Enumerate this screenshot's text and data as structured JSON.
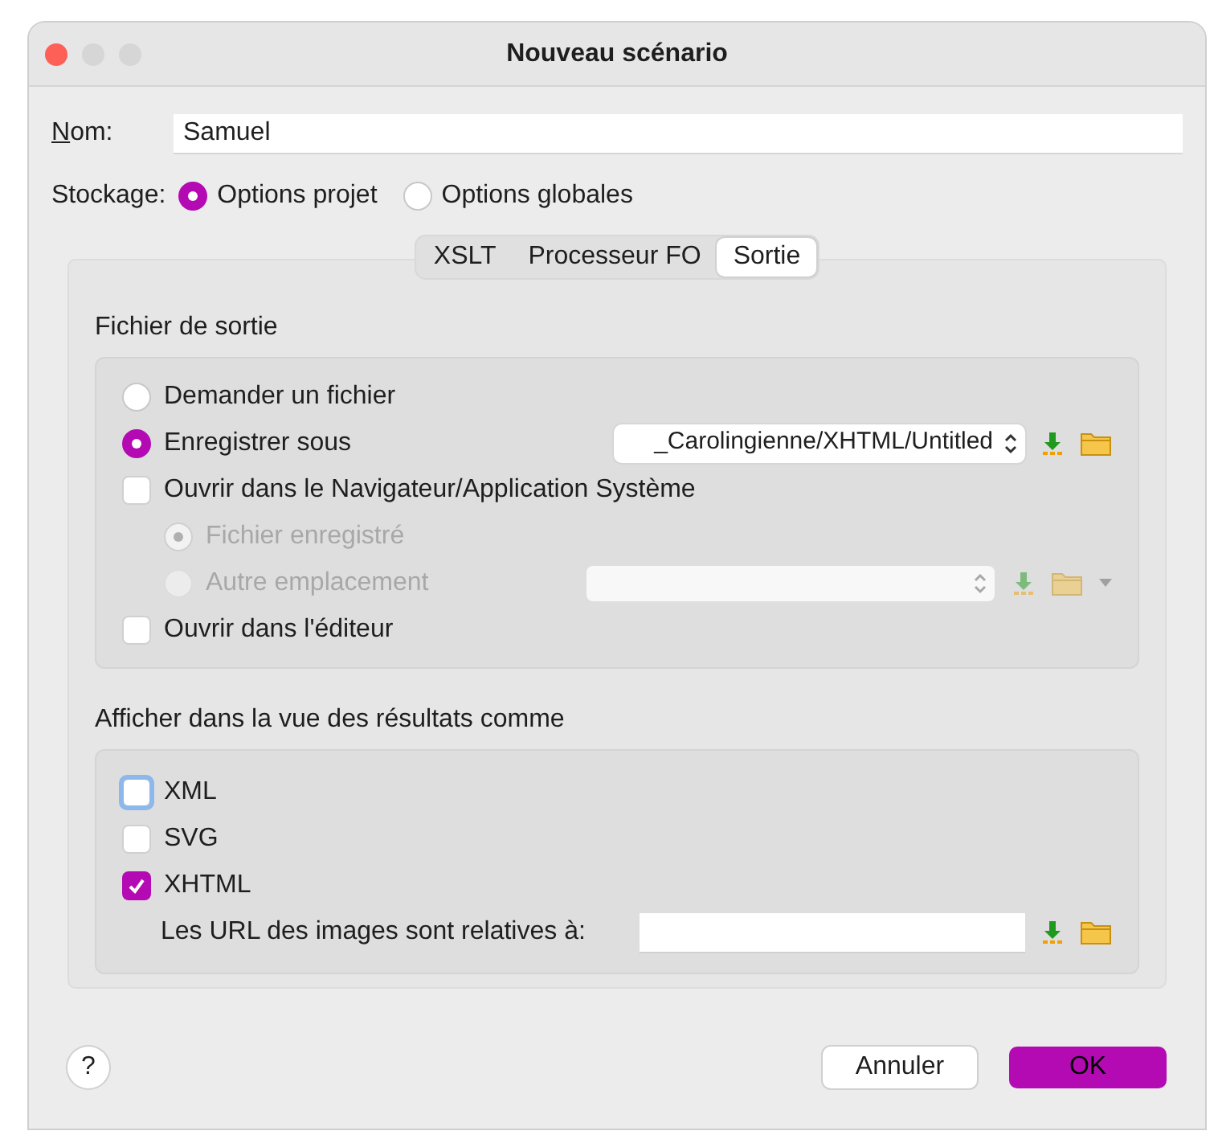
{
  "window": {
    "title": "Nouveau scénario"
  },
  "name_field": {
    "label": "Nom:",
    "value": "Samuel"
  },
  "storage": {
    "label": "Stockage:",
    "options": [
      {
        "label": "Options projet",
        "selected": true
      },
      {
        "label": "Options globales",
        "selected": false
      }
    ]
  },
  "tabs": [
    {
      "label": "XSLT",
      "selected": false
    },
    {
      "label": "Processeur FO",
      "selected": false
    },
    {
      "label": "Sortie",
      "selected": true
    }
  ],
  "output_file": {
    "title": "Fichier de sortie",
    "rows": [
      {
        "kind": "radio",
        "label": "Demander un fichier",
        "selected": false
      },
      {
        "kind": "radio",
        "label": "Enregistrer sous",
        "selected": true,
        "path": {
          "value": "_Carolingienne/XHTML/Untitled",
          "disabled": false
        }
      },
      {
        "kind": "checkbox",
        "label": "Ouvrir dans le Navigateur/Application Système",
        "checked": false,
        "children": [
          {
            "kind": "radio",
            "label": "Fichier enregistré",
            "selected": true,
            "disabled": true
          },
          {
            "kind": "radio",
            "label": "Autre emplacement",
            "selected": false,
            "disabled": true,
            "path": {
              "disabled": true,
              "menu": true
            }
          }
        ]
      },
      {
        "kind": "checkbox",
        "label": "Ouvrir dans l'éditeur",
        "checked": false
      }
    ]
  },
  "results": {
    "title": "Afficher dans la vue des résultats comme",
    "formats": [
      {
        "label": "XML",
        "checked": false,
        "focused": true
      },
      {
        "label": "SVG",
        "checked": false,
        "focused": false
      },
      {
        "label": "XHTML",
        "checked": true,
        "focused": false
      }
    ],
    "image_urls": {
      "label": "Les URL des images sont relatives à:"
    }
  },
  "buttons": {
    "help": "?",
    "cancel": "Annuler",
    "ok": "OK"
  }
}
